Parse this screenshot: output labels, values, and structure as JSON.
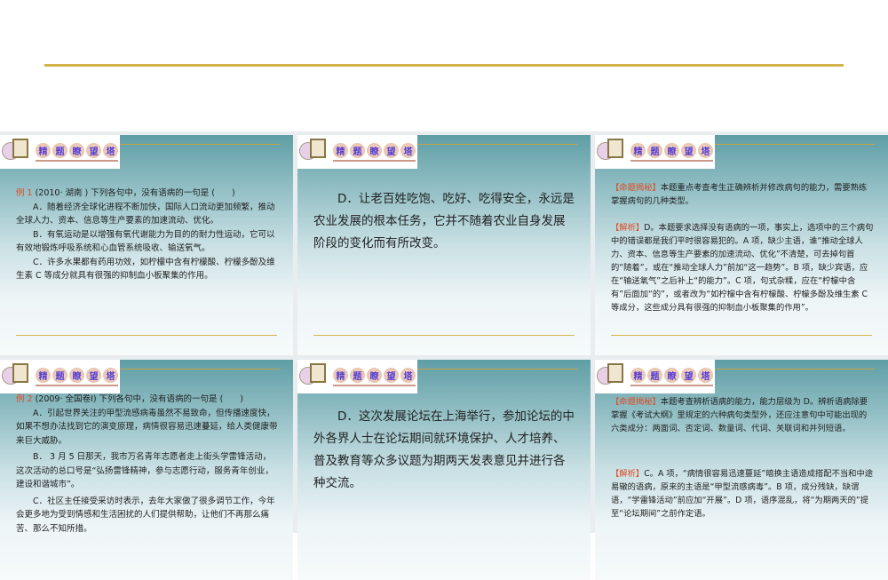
{
  "banner": [
    "精",
    "题",
    "瞭",
    "望",
    "塔"
  ],
  "slides": [
    {
      "label": "例 1",
      "head": " (2010· 湖南 ) 下列各句中，没有语病的一句是 (　　)",
      "a": "A．随着经济全球化进程不断加快，国际人口流动更加频繁，推动全球人力、资本、信息等生产要素的加速流动、优化。",
      "b": "B．有氧运动是以增强有氧代谢能力为目的的耐力性运动，它可以有效地锻炼呼吸系统和心血管系统吸收、输送氧气。",
      "c": "C．许多水果都有药用功效，如柠檬中含有柠檬酸、柠檬多酚及维生素 C 等成分就具有很强的抑制血小板聚集的作用。"
    },
    {
      "d": "D．让老百姓吃饱、吃好、吃得安全，永远是农业发展的根本任务，它并不随着农业自身发展阶段的变化而有所改变。"
    },
    {
      "tag1": "【命题揭秘】",
      "t1": "本题重点考查考生正确辨析并修改病句的能力，需要熟练掌握病句的几种类型。",
      "tag2": "【解析】",
      "t2": "D。本题要求选择没有语病的一项，事实上，选项中的三个病句中的错误都是我们平时很容易犯的。A 项，缺少主语，谁“推动全球人力、资本、信息等生产要素的加速流动、优化”不清楚，可去掉句首的“随着”，或在“推动全球人力”前加“这一趋势”。B 项，缺少宾语，应在“输送氧气”之后补上“的能力”。C 项，句式杂糅，应在“柠檬中含有”后面加“的”，或者改为“如柠檬中含有柠檬酸、柠檬多酚及维生素 C 等成分，这些成分具有很强的抑制血小板聚集的作用”。"
    },
    {
      "label": "例 2",
      "head": " (2009· 全国卷Ⅰ) 下列各句中，没有语病的一句是 (　　)",
      "a": "A．引起世界关注的甲型流感病毒虽然不易致命，但传播速度快，如果不想办法找到它的演变原理，病情很容易迅速蔓延，给人类健康带来巨大威胁。",
      "b": "B． 3 月 5 日那天，我市万名青年志愿者走上街头学雷锋活动，这次活动的总口号是“弘扬雷锋精神，参与志愿行动，服务青年创业，建设和谐城市”。",
      "c": "C．社区主任接受采访时表示，去年大家做了很多调节工作，今年会更多地为受到情感和生活困扰的人们提供帮助，让他们不再那么痛苦、那么不知所措。"
    },
    {
      "d": "D．这次发展论坛在上海举行，参加论坛的中外各界人士在论坛期间就环境保护、人才培养、普及教育等众多议题为期两天发表意见并进行各种交流。"
    },
    {
      "tag1": "【命题揭秘】",
      "t1": "本题考查辨析语病的能力，能力层级为 D。辨析语病除要掌握《考试大纲》里规定的六种病句类型外，还应注意句中可能出现的六类成分：两面词、否定词、数量词、代词、关联词和并列短语。",
      "tag2": "【解析】",
      "t2": "C。A 项，“病情很容易迅速蔓延”暗换主语造成搭配不当和中途易辙的语病，原来的主语是“甲型流感病毒”。B 项，成分残缺，缺谓语，“学雷锋活动”前应加“开展”。D 项，语序混乱，将“为期两天的”提至“论坛期间”之前作定语。"
    }
  ]
}
